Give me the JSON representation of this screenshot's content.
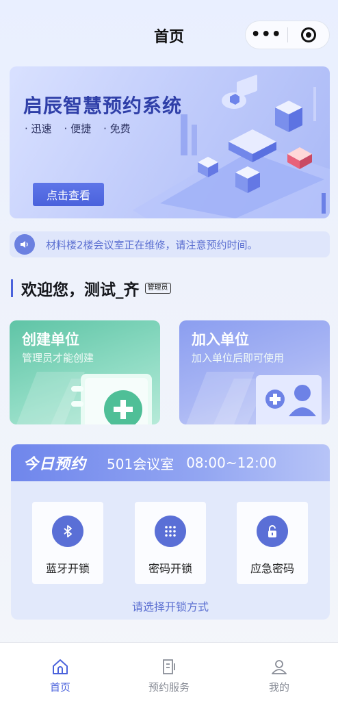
{
  "header": {
    "title": "首页"
  },
  "banner": {
    "title": "启辰智慧预约系统",
    "tags": [
      "· 迅速",
      "· 便捷",
      "· 免费"
    ],
    "button_label": "点击查看"
  },
  "notice": {
    "text": "材料楼2楼会议室正在维修，请注意预约时间。"
  },
  "welcome": {
    "text": "欢迎您，测试_齐",
    "role_badge": "管理员"
  },
  "cards": {
    "create": {
      "title": "创建单位",
      "subtitle": "管理员才能创建"
    },
    "join": {
      "title": "加入单位",
      "subtitle": "加入单位后即可使用"
    }
  },
  "today": {
    "label": "今日预约",
    "room": "501会议室",
    "time": "08:00~12:00",
    "options": [
      {
        "label": "蓝牙开锁",
        "icon": "bluetooth-icon"
      },
      {
        "label": "密码开锁",
        "icon": "keypad-icon"
      },
      {
        "label": "应急密码",
        "icon": "lock-icon"
      }
    ],
    "hint": "请选择开锁方式"
  },
  "tabbar": {
    "items": [
      {
        "label": "首页",
        "icon": "home-icon",
        "active": true
      },
      {
        "label": "预约服务",
        "icon": "document-icon",
        "active": false
      },
      {
        "label": "我的",
        "icon": "user-icon",
        "active": false
      }
    ]
  },
  "colors": {
    "accent": "#4a62dc",
    "create_card": "#5fc4a6",
    "join_card": "#8b9ef0"
  }
}
